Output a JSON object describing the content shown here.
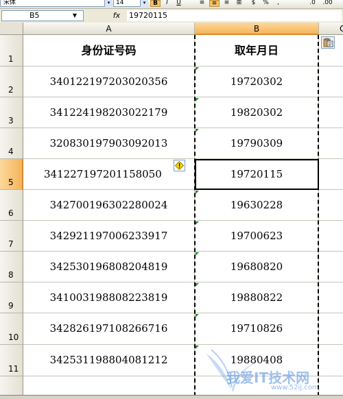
{
  "toolbar": {
    "font_name": "宋体",
    "font_size": "14",
    "bold_label": "B",
    "italic_label": "I",
    "underline_label": "U",
    "percent_label": "%"
  },
  "formula_bar": {
    "name_box": "B5",
    "fx_label": "fx",
    "value": "19720115"
  },
  "columns": [
    {
      "label": "A"
    },
    {
      "label": "B"
    },
    {
      "label": "C"
    }
  ],
  "rows": [
    {
      "num": "1",
      "a": "身份证号码",
      "b": "取年月日"
    },
    {
      "num": "2",
      "a": "340122197203020356",
      "b": "19720302"
    },
    {
      "num": "3",
      "a": "341224198203022179",
      "b": "19820302"
    },
    {
      "num": "4",
      "a": "320830197903092013",
      "b": "19790309"
    },
    {
      "num": "5",
      "a": "341227197201158050",
      "b": "19720115"
    },
    {
      "num": "6",
      "a": "342700196302280024",
      "b": "19630228"
    },
    {
      "num": "7",
      "a": "342921197006233917",
      "b": "19700623"
    },
    {
      "num": "8",
      "a": "342530196808204819",
      "b": "19680820"
    },
    {
      "num": "9",
      "a": "341003198808223819",
      "b": "19880822"
    },
    {
      "num": "10",
      "a": "342826197108266716",
      "b": "19710826"
    },
    {
      "num": "11",
      "a": "342531198804081212",
      "b": "19880408"
    }
  ],
  "selection": {
    "active_cell": "B5"
  },
  "colors": {
    "selected_header": "#f7b45c",
    "error_indicator": "#2a8a2a",
    "warning": "#e8c800"
  },
  "watermark": {
    "text": "我爱IT技术网",
    "url": "www.52ij.com"
  }
}
